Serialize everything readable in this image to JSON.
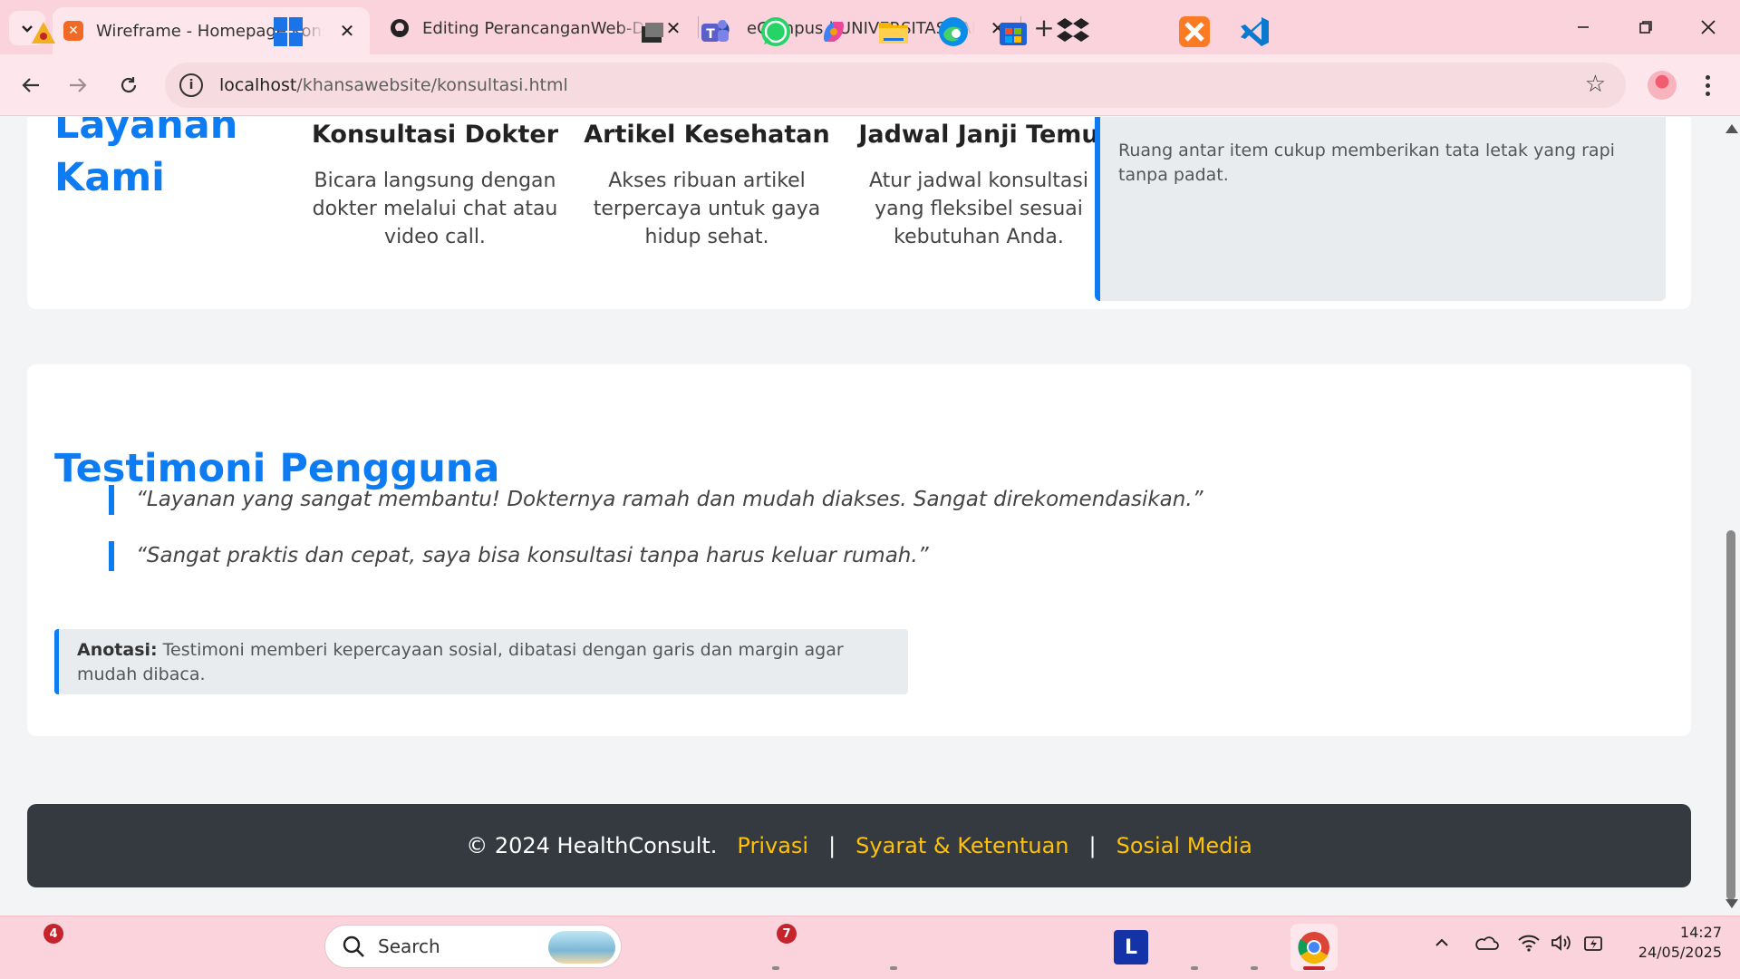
{
  "browser": {
    "tabs": [
      {
        "title": "Wireframe - Homepage Konsultasi",
        "active": true,
        "favicon": "xampp-icon"
      },
      {
        "title": "Editing PerancanganWeb-Desain",
        "active": false,
        "favicon": "github-icon"
      },
      {
        "title": "eCampus | UNIVERSITAS TANGERANG",
        "active": false,
        "favicon": "ecampus-flame-icon"
      }
    ],
    "url_host": "localhost",
    "url_path": "/khansawebsite/konsultasi.html"
  },
  "services_section": {
    "title": "Layanan Kami",
    "items": [
      {
        "heading": "Konsultasi Dokter",
        "text": "Bicara langsung dengan dokter melalui chat atau video call."
      },
      {
        "heading": "Artikel Kesehatan",
        "text": "Akses ribuan artikel terpercaya untuk gaya hidup sehat."
      },
      {
        "heading": "Jadwal Janji Temu",
        "text": "Atur jadwal konsultasi yang fleksibel sesuai kebutuhan Anda."
      }
    ],
    "annotation_text": "Ruang antar item cukup memberikan tata letak yang rapi tanpa padat."
  },
  "testimonials_section": {
    "title": "Testimoni Pengguna",
    "quotes": [
      "“Layanan yang sangat membantu! Dokternya ramah dan mudah diakses. Sangat direkomendasikan.”",
      "“Sangat praktis dan cepat, saya bisa konsultasi tanpa harus keluar rumah.”"
    ],
    "annotation_label": "Anotasi:",
    "annotation_text": "Testimoni memberi kepercayaan sosial, dibatasi dengan garis dan margin agar mudah dibaca."
  },
  "footer": {
    "copyright": "© 2024 HealthConsult.",
    "links": [
      "Privasi",
      "Syarat & Ketentuan",
      "Sosial Media"
    ],
    "separator": "|"
  },
  "taskbar": {
    "search_placeholder": "Search",
    "weather_badge": "4",
    "whatsapp_badge": "7",
    "time": "14:27",
    "date": "24/05/2025"
  },
  "colors": {
    "accent": "#0d7cf2",
    "footer_bg": "#343a40",
    "footer_link": "#ffc107",
    "chrome_pink": "#fbd3dc"
  }
}
